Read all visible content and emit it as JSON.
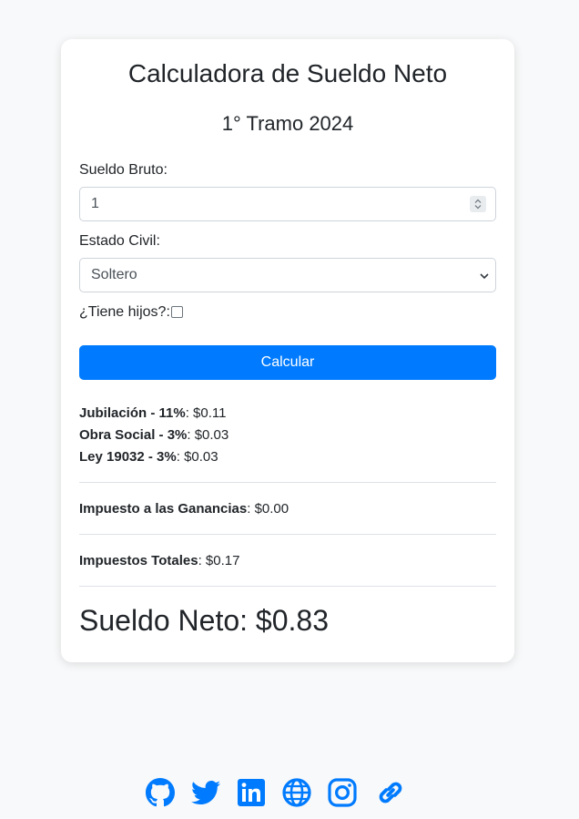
{
  "card": {
    "title": "Calculadora de Sueldo Neto",
    "subtitle": "1° Tramo 2024"
  },
  "form": {
    "gross_label": "Sueldo Bruto:",
    "gross_value": "1",
    "civil_label": "Estado Civil:",
    "civil_value": "Soltero",
    "children_label": "¿Tiene hijos?:",
    "children_checked": false,
    "submit_label": "Calcular"
  },
  "results": {
    "jubilacion_label": "Jubilación - 11%",
    "jubilacion_value": ": $0.11",
    "obra_social_label": "Obra Social - 3%",
    "obra_social_value": ": $0.03",
    "ley_label": "Ley 19032 - 3%",
    "ley_value": ": $0.03",
    "ganancias_label": "Impuesto a las Ganancias",
    "ganancias_value": ": $0.00",
    "totales_label": "Impuestos Totales",
    "totales_value": ": $0.17",
    "net": "Sueldo Neto: $0.83"
  },
  "footer": {
    "icons": [
      "github-icon",
      "twitter-icon",
      "linkedin-icon",
      "globe-icon",
      "instagram-icon",
      "link-icon"
    ]
  },
  "colors": {
    "accent": "#007bff",
    "background": "#f8f9fa"
  }
}
